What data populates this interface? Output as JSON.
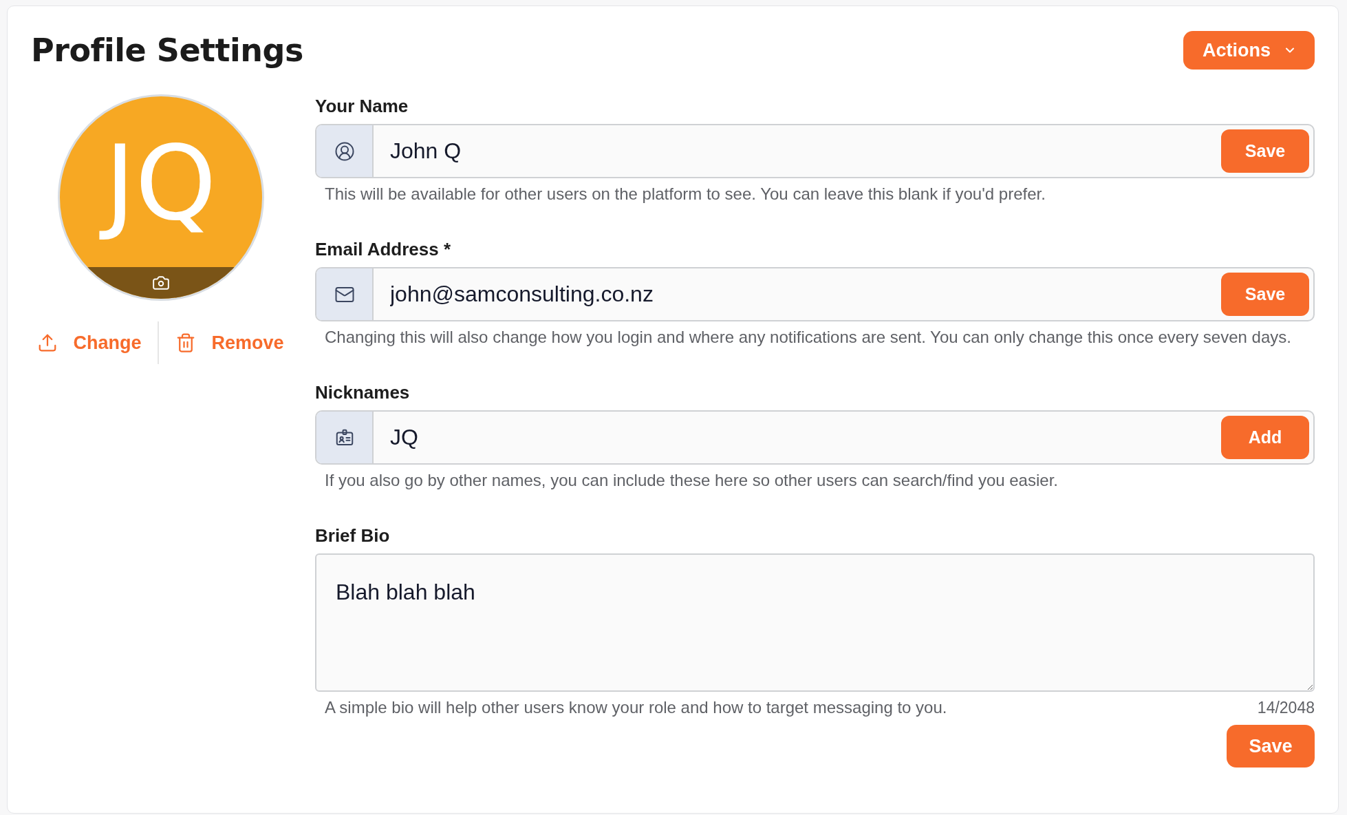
{
  "title": "Profile Settings",
  "actions_button": {
    "label": "Actions"
  },
  "avatar": {
    "initials": "JQ"
  },
  "avatar_actions": [
    {
      "kind": "upload",
      "label": "Change"
    },
    {
      "kind": "delete",
      "label": "Remove"
    }
  ],
  "fields": [
    {
      "kind": "input",
      "label": "Your Name",
      "value": "John Q",
      "button": "Save",
      "hint": "This will be available for other users on the platform to see. You can leave this blank if you'd prefer."
    },
    {
      "kind": "input",
      "label": "Email Address *",
      "value": "john@samconsulting.co.nz",
      "button": "Save",
      "hint": "Changing this will also change how you login and where any notifications are sent. You can only change this once every seven days."
    },
    {
      "kind": "input",
      "label": "Nicknames",
      "value": "JQ",
      "button": "Add",
      "hint": "If you also go by other names, you can include these here so other users can search/find you easier."
    },
    {
      "kind": "textarea",
      "label": "Brief Bio",
      "value": "Blah blah blah",
      "hint": "A simple bio will help other users know your role and how to target messaging to you.",
      "counter": "14/2048"
    }
  ],
  "save_button": {
    "label": "Save"
  }
}
